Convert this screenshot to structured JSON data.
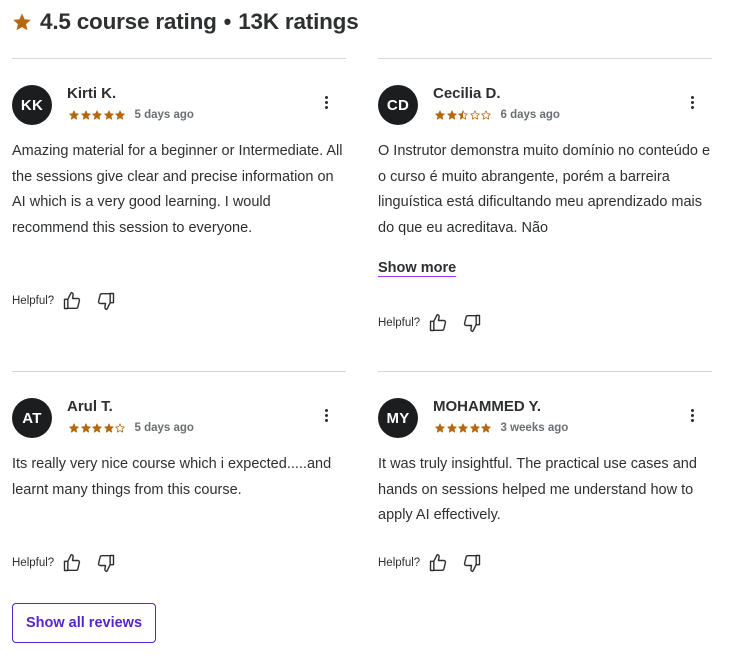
{
  "summary": {
    "rating_text": "4.5 course rating",
    "separator": "•",
    "count_text": "13K ratings",
    "star_color": "#b4690e"
  },
  "reviews": [
    {
      "initials": "KK",
      "name": "Kirti K.",
      "rating": 5,
      "time": "5 days ago",
      "text": "Amazing material for a beginner or Intermediate. All the sessions give clear and precise information on AI which is a very good learning. I would recommend this session to everyone.",
      "helpful_label": "Helpful?"
    },
    {
      "initials": "CD",
      "name": "Cecilia D.",
      "rating": 2.5,
      "time": "6 days ago",
      "text": "O Instrutor demonstra muito domínio no conteúdo e o curso é muito abrangente, porém a barreira linguística está dificultando meu aprendizado mais do que eu acreditava. Não",
      "show_more": "Show more",
      "helpful_label": "Helpful?"
    },
    {
      "initials": "AT",
      "name": "Arul T.",
      "rating": 4,
      "time": "5 days ago",
      "text": "Its really very nice course which i expected.....and learnt many things from this course.",
      "helpful_label": "Helpful?"
    },
    {
      "initials": "MY",
      "name": "MOHAMMED Y.",
      "rating": 5,
      "time": "3 weeks ago",
      "text": "It was truly insightful. The practical use cases and hands on sessions helped me understand how to apply AI effectively.",
      "helpful_label": "Helpful?"
    }
  ],
  "show_all_label": "Show all reviews",
  "colors": {
    "brand": "#5624d0",
    "accent_underline": "#a435f0",
    "star": "#b4690e",
    "avatar_bg": "#1c1d1f"
  }
}
